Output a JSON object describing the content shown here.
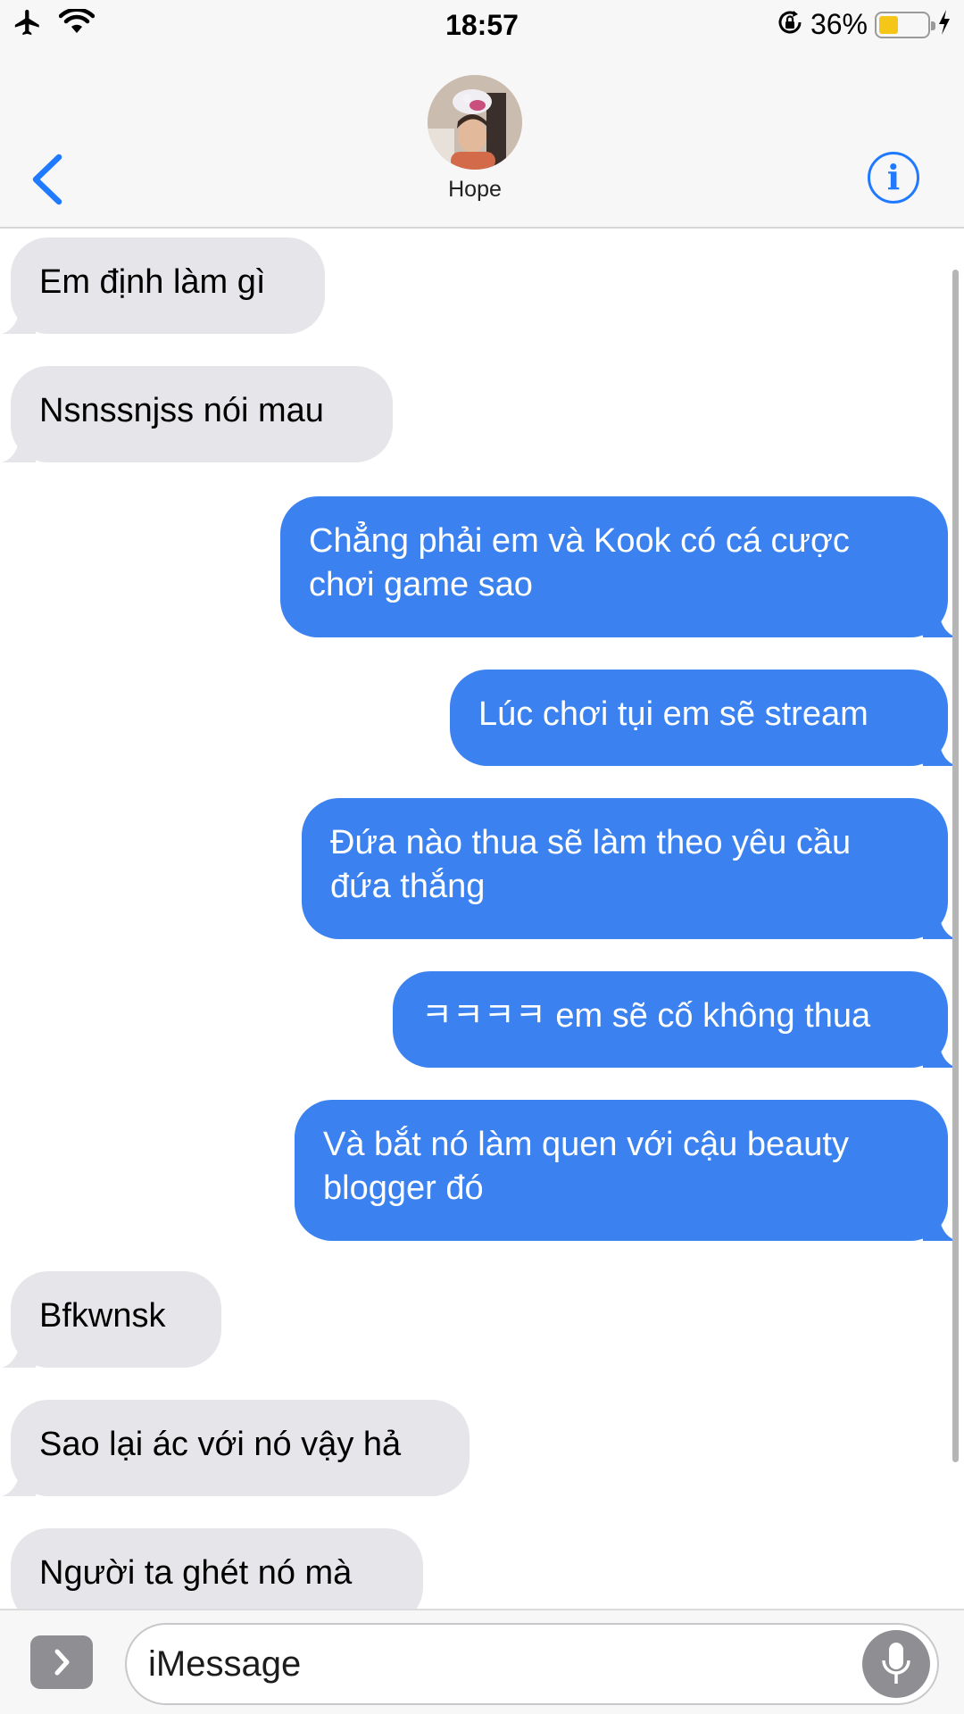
{
  "status_bar": {
    "time": "18:57",
    "battery_percent": "36%",
    "battery_level": 0.36,
    "icons": [
      "airplane-icon",
      "wifi-icon",
      "orientation-lock-icon",
      "battery-icon",
      "charging-icon"
    ]
  },
  "header": {
    "contact_name": "Hope",
    "back_icon": "chevron-left-icon",
    "info_label": "i"
  },
  "messages": [
    {
      "from": "them",
      "text": "Em định làm gì"
    },
    {
      "from": "them",
      "text": "Nsnssnjss nói mau"
    },
    {
      "from": "me",
      "line1": "Chẳng phải em và Kook có cá cược",
      "line2": "chơi game sao"
    },
    {
      "from": "me",
      "text": "Lúc chơi tụi em sẽ stream"
    },
    {
      "from": "me",
      "line1": "Đứa nào thua sẽ làm theo yêu cầu",
      "line2": "đứa thắng"
    },
    {
      "from": "me",
      "text": "ㅋㅋㅋㅋ em sẽ cố không thua"
    },
    {
      "from": "me",
      "line1": "Và bắt nó làm quen với cậu beauty",
      "line2": "blogger đó"
    },
    {
      "from": "them",
      "text": "Bfkwnsk"
    },
    {
      "from": "them",
      "text": "Sao lại ác với nó vậy hả"
    },
    {
      "from": "them",
      "text": "Người ta ghét nó mà"
    }
  ],
  "input": {
    "placeholder": "iMessage",
    "value": ""
  },
  "colors": {
    "sent_bubble": "#3b82f0",
    "received_bubble": "#e6e6ea",
    "accent": "#1f7aff",
    "bar_background": "#f7f7f7"
  }
}
